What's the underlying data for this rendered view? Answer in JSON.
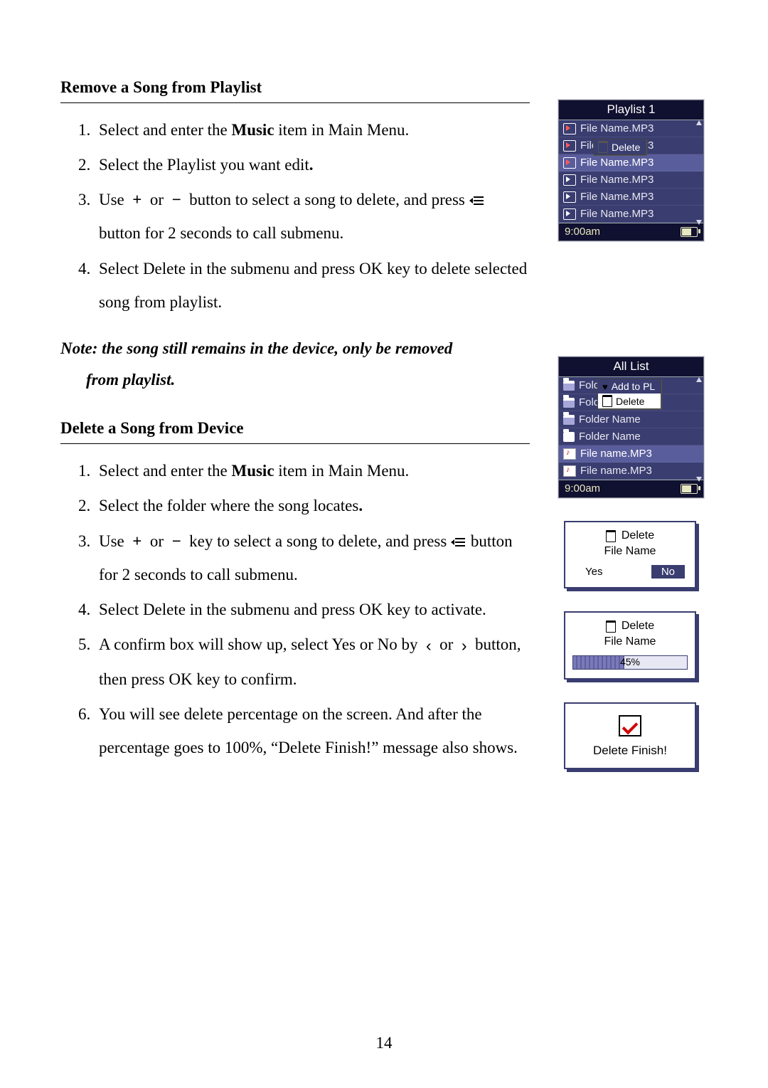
{
  "page_number": "14",
  "section1": {
    "heading": "Remove a Song from Playlist",
    "steps": [
      "Select and enter the Music item in Main Menu.",
      "Select the Playlist you want edit.",
      "Use + or − button to select a song to delete, and press   button for 2 seconds to call submenu.",
      "Select Delete in the submenu and press OK key to delete selected song from playlist."
    ],
    "note_line1": "Note: the song still remains in the device, only be removed",
    "note_line2": "from playlist."
  },
  "section2": {
    "heading": "Delete a Song from Device",
    "steps": [
      "Select and enter the Music item in Main Menu.",
      "Select the folder where the song locates.",
      "Use + or − key to select a song to delete, and press   button for 2 seconds to call submenu.",
      "Select Delete in the submenu and press OK key to activate.",
      "A confirm box will show up, select Yes or No by  ‹  or  ›  button, then press OK key to confirm.",
      "You will see delete percentage on the screen. And after the percentage goes to 100%, “Delete Finish!” message also shows."
    ]
  },
  "fig_playlist": {
    "title": "Playlist 1",
    "rows": [
      "File Name.MP3",
      "File Name.MP3",
      "File Name.MP3",
      "File Name.MP3",
      "File Name.MP3",
      "File Name.MP3"
    ],
    "submenu_delete": "Delete",
    "time": "9:00am"
  },
  "fig_alllist": {
    "title": "All List",
    "rows": [
      "Folder Name",
      "Folder Name",
      "Folder Name",
      "Folder Name",
      "File name.MP3",
      "File name.MP3"
    ],
    "submenu_add": "Add to PL",
    "submenu_delete": "Delete",
    "time": "9:00am"
  },
  "fig_confirm": {
    "title": "Delete",
    "name": "File Name",
    "yes": "Yes",
    "no": "No"
  },
  "fig_progress": {
    "title": "Delete",
    "name": "File Name",
    "percent": "45%"
  },
  "fig_finish": {
    "text": "Delete Finish!"
  }
}
